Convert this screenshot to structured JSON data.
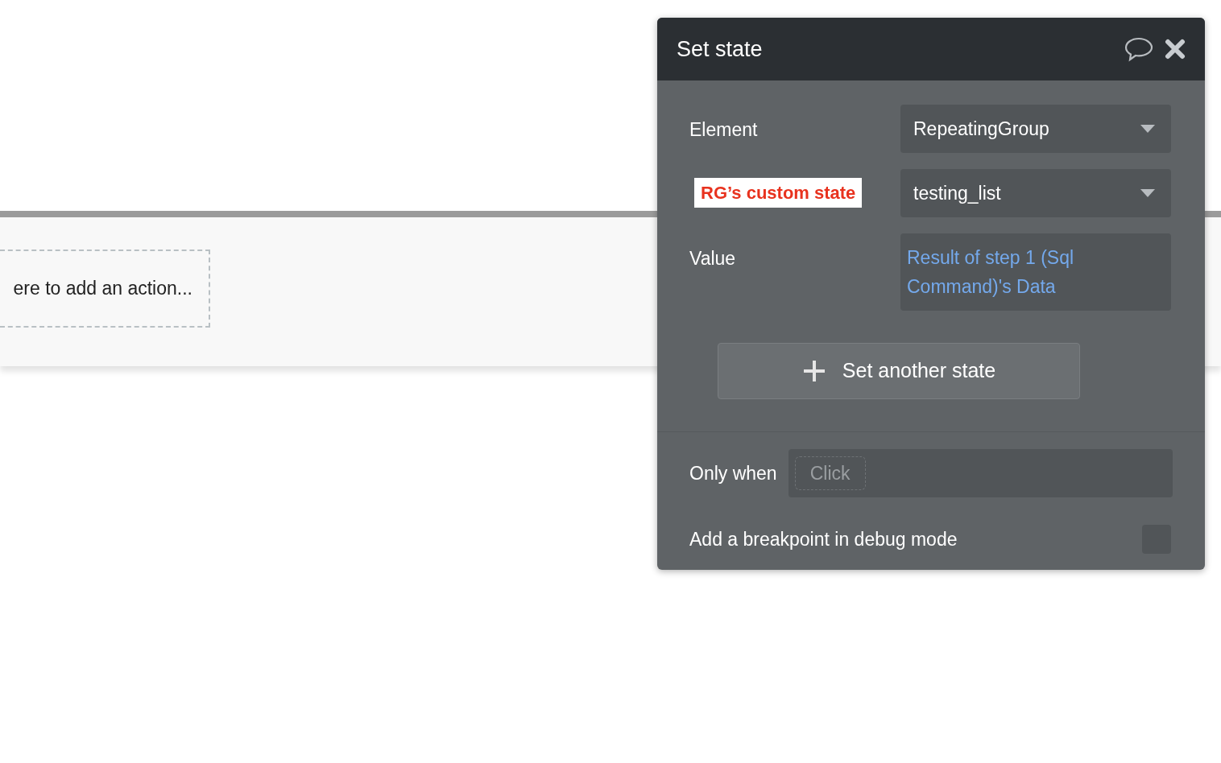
{
  "canvas": {
    "action_placeholder": "ere to add an action..."
  },
  "panel": {
    "title": "Set state",
    "fields": [
      {
        "kind": "dropdown",
        "label": "Element",
        "value": "RepeatingGroup"
      },
      {
        "kind": "dropdown",
        "annotation": "RG’s custom state",
        "value": "testing_list"
      },
      {
        "kind": "expression",
        "label": "Value",
        "value": "Result of step 1 (Sql Command)'s Data"
      }
    ],
    "add_button": "Set another state",
    "only_when": {
      "label": "Only when",
      "placeholder": "Click"
    },
    "breakpoint": {
      "label": "Add a breakpoint in debug mode",
      "checked": false
    }
  }
}
